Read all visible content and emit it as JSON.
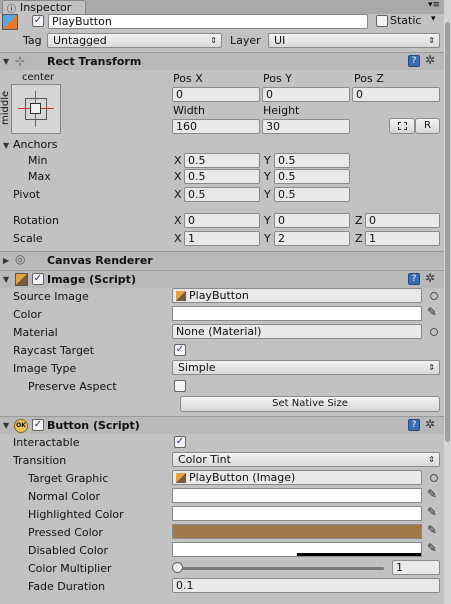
{
  "tab": {
    "label": "Inspector"
  },
  "object": {
    "name": "PlayButton",
    "static_label": "Static",
    "tag_label": "Tag",
    "tag_value": "Untagged",
    "layer_label": "Layer",
    "layer_value": "UI"
  },
  "rect": {
    "title": "Rect Transform",
    "anchor_h": "center",
    "anchor_v": "middle",
    "posx_label": "Pos X",
    "posy_label": "Pos Y",
    "posz_label": "Pos Z",
    "posx": "0",
    "posy": "0",
    "posz": "0",
    "width_label": "Width",
    "height_label": "Height",
    "width": "160",
    "height": "30",
    "r_label": "R",
    "anchors_label": "Anchors",
    "min_label": "Min",
    "max_label": "Max",
    "pivot_label": "Pivot",
    "min_x": "0.5",
    "min_y": "0.5",
    "max_x": "0.5",
    "max_y": "0.5",
    "pivot_x": "0.5",
    "pivot_y": "0.5",
    "rotation_label": "Rotation",
    "scale_label": "Scale",
    "rot_x": "0",
    "rot_y": "0",
    "rot_z": "0",
    "scale_x": "1",
    "scale_y": "2",
    "scale_z": "1",
    "x": "X",
    "y": "Y",
    "z": "Z"
  },
  "canvas": {
    "title": "Canvas Renderer"
  },
  "image": {
    "title": "Image (Script)",
    "source_label": "Source Image",
    "source_value": "PlayButton",
    "color_label": "Color",
    "material_label": "Material",
    "material_value": "None (Material)",
    "raycast_label": "Raycast Target",
    "type_label": "Image Type",
    "type_value": "Simple",
    "preserve_label": "Preserve Aspect",
    "native_button": "Set Native Size"
  },
  "button": {
    "title": "Button (Script)",
    "interactable_label": "Interactable",
    "transition_label": "Transition",
    "transition_value": "Color Tint",
    "target_label": "Target Graphic",
    "target_value": "PlayButton (Image)",
    "normal_label": "Normal Color",
    "highlighted_label": "Highlighted Color",
    "pressed_label": "Pressed Color",
    "disabled_label": "Disabled Color",
    "multiplier_label": "Color Multiplier",
    "multiplier_value": "1",
    "fade_label": "Fade Duration",
    "fade_value": "0.1"
  },
  "colors": {
    "pressed": "#a0784a",
    "white": "#ffffff",
    "disabled_bar": "#000000"
  }
}
